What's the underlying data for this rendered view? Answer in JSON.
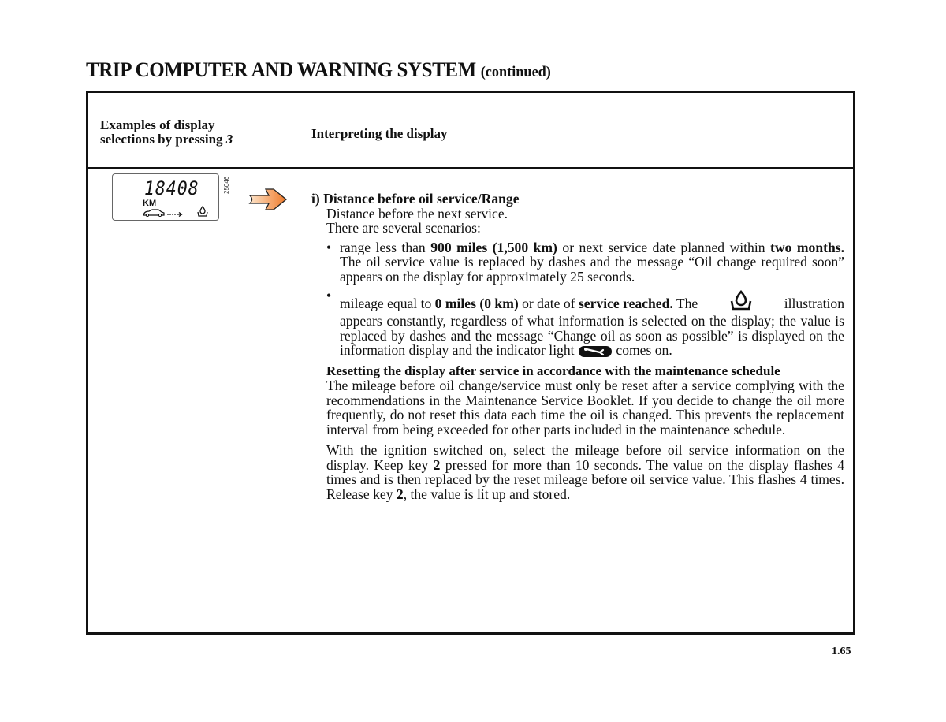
{
  "page": {
    "title": "TRIP COMPUTER AND WARNING SYSTEM",
    "title_suffix": "(continued)",
    "page_number": "1.65"
  },
  "table_header": {
    "col1_line1": "Examples of display",
    "col1_line2": "selections by pressing",
    "col1_key": "3",
    "col2": "Interpreting the display"
  },
  "display_example": {
    "digits": "18408",
    "unit": "KM",
    "figure_ref": "25046",
    "icons": [
      "car-distance-icon",
      "oil-can-icon",
      "orange-arrow-icon"
    ]
  },
  "section": {
    "title": "i) Distance before oil service/Range",
    "intro_1": "Distance before the next service.",
    "intro_2": "There are several scenarios:",
    "bullet1": {
      "t1": "range less than ",
      "b1": "900 miles (1,500 km)",
      "t2": " or next service date planned within ",
      "b2": "two months.",
      "t3": " The oil service value is replaced by dashes and the message “Oil change required soon” appears on the display for approximately 25 seconds."
    },
    "bullet2": {
      "t1": "mileage equal to ",
      "b1": "0 miles (0 km)",
      "t2": " or date of ",
      "b2": "service reached.",
      "t3": " The",
      "t4": "illustration",
      "t5": "appears constantly, regardless of what information is selected on the display; the value is replaced by dashes and the message “Change oil as soon as possible” is displayed on the information display and the indicator light",
      "t6": "comes on."
    },
    "reset_title": "Resetting the display after service in accordance with the maintenance schedule",
    "reset_para1": "The mileage before oil change/service must only be reset after a service complying with the recommendations in the Maintenance Service Booklet. If you decide to change the oil more frequently, do not reset this data each time the oil is changed. This prevents the replacement interval from being exceeded for other parts included in the maintenance schedule.",
    "reset_para2": {
      "t1": "With the ignition switched on, select the mileage before oil service information on the display. Keep key ",
      "k1": "2",
      "t2": " pressed for more than 10 seconds. The value on the display flashes 4 times and is then replaced by the reset mileage before oil service value. This flashes 4 times. Release key ",
      "k2": "2",
      "t3": ", the value is lit up and stored."
    }
  },
  "colors": {
    "arrow_orange": "#f08a3c",
    "frame": "#111111"
  }
}
